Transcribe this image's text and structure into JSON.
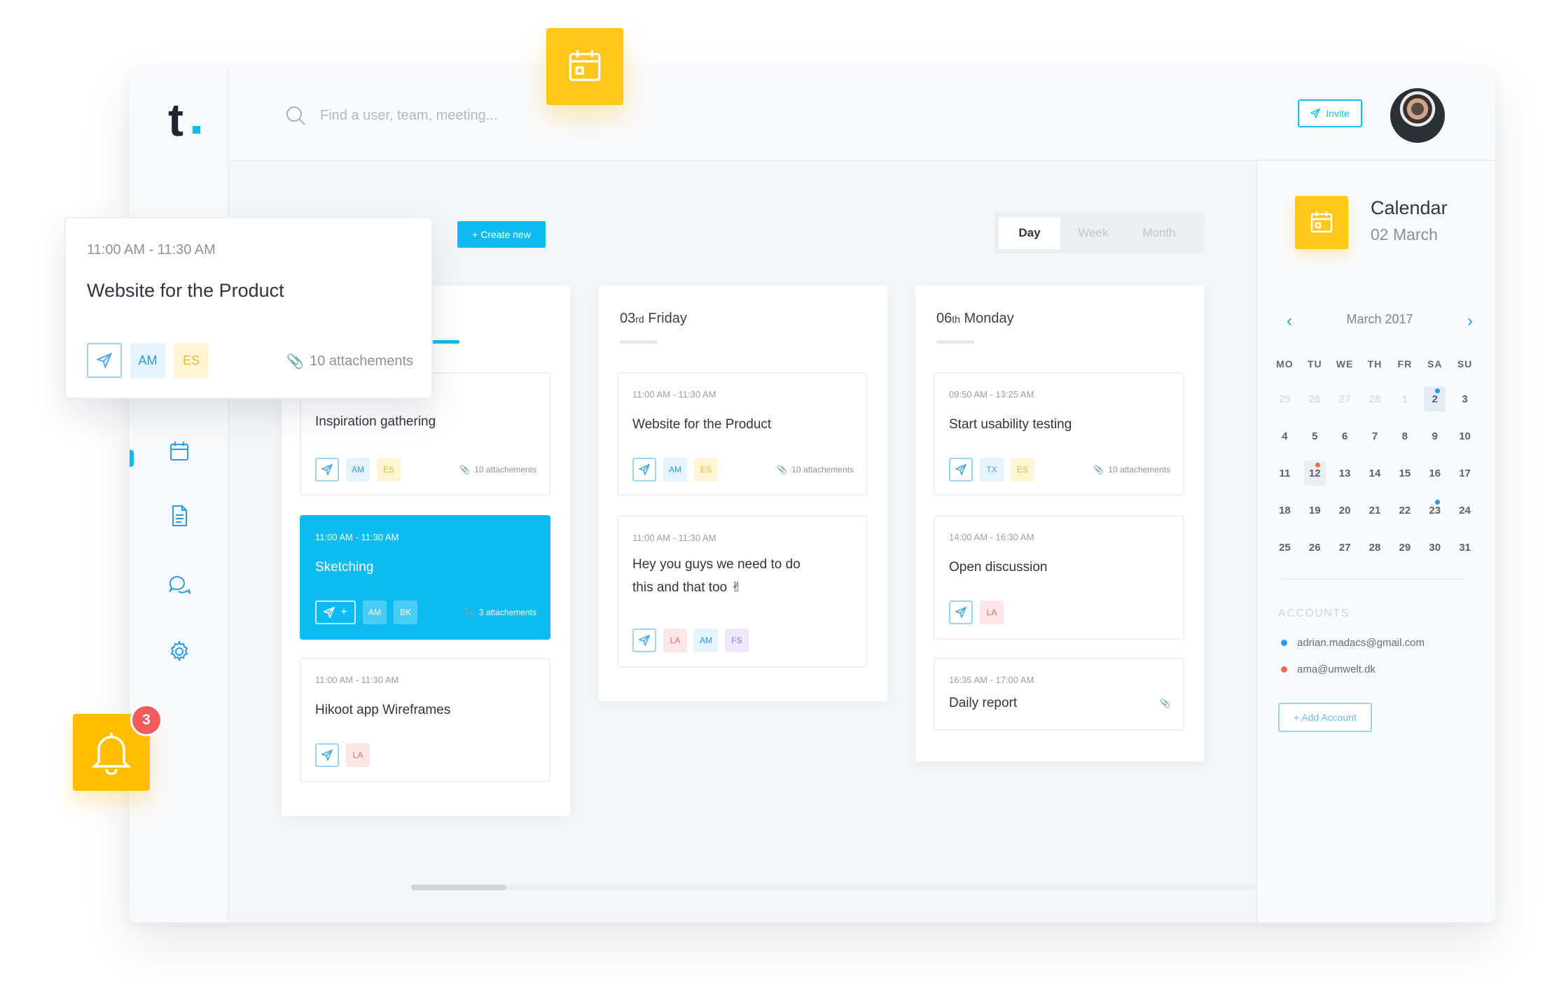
{
  "app": {
    "logo": "t",
    "search": {
      "placeholder": "Find a user, team, meeting..."
    },
    "invite_label": "Invite"
  },
  "sidebar": {
    "items": [
      "calendar-icon",
      "document-icon",
      "chat-icon",
      "gear-icon"
    ]
  },
  "toolbar": {
    "create_label": "+ Create new"
  },
  "view_tabs": {
    "day": "Day",
    "week": "Week",
    "month": "Month",
    "selected": "Day"
  },
  "columns": [
    {
      "cards": [
        {
          "time": "",
          "title": "Inspiration gathering",
          "tags": [
            "AM",
            "ES"
          ],
          "attachments": "10 attachements"
        },
        {
          "time": "11:00 AM - 11:30 AM",
          "title": "Sketching",
          "tags": [
            "AM",
            "BK"
          ],
          "attachments": "3 attachements",
          "active": true,
          "send_plus": "+"
        },
        {
          "time": "11:00 AM - 11:30 AM",
          "title": "Hikoot app Wireframes",
          "tags": [
            "LA"
          ],
          "attachments": ""
        }
      ]
    },
    {
      "heading_day": "03",
      "heading_suffix": "rd",
      "heading_rest": " Friday",
      "cards": [
        {
          "time": "11:00 AM - 11:30 AM",
          "title": "Website for the Product",
          "tags": [
            "AM",
            "ES"
          ],
          "attachments": "10 attachements"
        },
        {
          "time": "11:00 AM - 11:30 AM",
          "title": "Hey you guys we need to do this and that too ✌",
          "tags": [
            "LA",
            "AM",
            "FS"
          ],
          "attachments": ""
        }
      ]
    },
    {
      "heading_day": "06",
      "heading_suffix": "th",
      "heading_rest": " Monday",
      "cards": [
        {
          "time": "09:50 AM - 13:25 AM",
          "title": "Start usability testing",
          "tags": [
            "TX",
            "ES"
          ],
          "attachments": "10 attachements"
        },
        {
          "time": "14:00 AM - 16:30 AM",
          "title": "Open discussion",
          "tags": [
            "LA"
          ],
          "attachments": ""
        },
        {
          "time": "16:35 AM - 17:00 AM",
          "title": "Daily report",
          "tags": [],
          "attachments": ""
        }
      ]
    }
  ],
  "popup": {
    "time": "11:00 AM - 11:30 AM",
    "title": "Website for the Product",
    "tags": [
      "AM",
      "ES"
    ],
    "attachments": "10 attachements"
  },
  "calendar": {
    "title": "Calendar",
    "date": "02 March",
    "month_label": "March 2017",
    "weekdays": [
      "MO",
      "TU",
      "WE",
      "TH",
      "FR",
      "SA",
      "SU"
    ],
    "weeks": [
      [
        "25",
        "26",
        "27",
        "28",
        "1",
        "2",
        "3"
      ],
      [
        "4",
        "5",
        "6",
        "7",
        "8",
        "9",
        "10"
      ],
      [
        "11",
        "12",
        "13",
        "14",
        "15",
        "16",
        "17"
      ],
      [
        "18",
        "19",
        "20",
        "21",
        "22",
        "23",
        "24"
      ],
      [
        "25",
        "26",
        "27",
        "28",
        "29",
        "30",
        "31"
      ]
    ]
  },
  "accounts": {
    "heading": "ACCOUNTS",
    "items": [
      {
        "email": "adrian.madacs@gmail.com",
        "color": "#2b9ae6"
      },
      {
        "email": "ama@umwelt.dk",
        "color": "#f06b4f"
      }
    ],
    "add_label": "+ Add Account"
  },
  "notifications": {
    "count": "3"
  },
  "colors": {
    "accent": "#0cbcf0",
    "yellow": "#ffc81a",
    "red": "#f25b5b"
  }
}
